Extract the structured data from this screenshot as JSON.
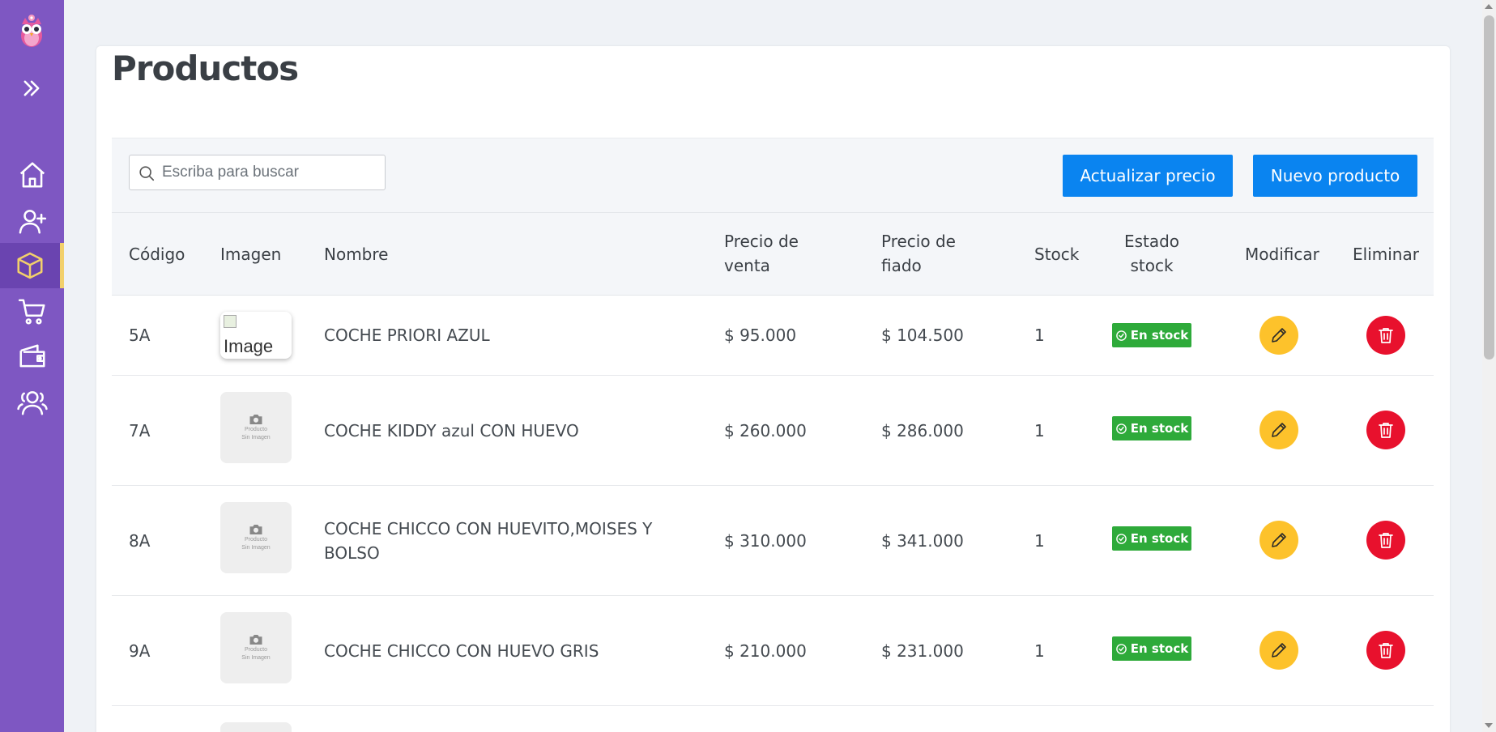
{
  "sidebar": {
    "logo": "owl-logo",
    "items": [
      {
        "icon": "home-icon",
        "active": false
      },
      {
        "icon": "add-user-icon",
        "active": false
      },
      {
        "icon": "box-icon",
        "active": true
      },
      {
        "icon": "cart-icon",
        "active": false
      },
      {
        "icon": "wallet-icon",
        "active": false
      },
      {
        "icon": "users-icon",
        "active": false
      }
    ],
    "accent": "#f2d06b"
  },
  "page": {
    "title": "Productos"
  },
  "toolbar": {
    "search_placeholder": "Escriba para buscar",
    "update_price_label": "Actualizar precio",
    "new_product_label": "Nuevo producto"
  },
  "table": {
    "headers": {
      "codigo": "Código",
      "imagen": "Imagen",
      "nombre": "Nombre",
      "precio_venta_1": "Precio de",
      "precio_venta_2": "venta",
      "precio_fiado_1": "Precio de",
      "precio_fiado_2": "fiado",
      "stock": "Stock",
      "estado_1": "Estado",
      "estado_2": "stock",
      "modificar": "Modificar",
      "eliminar": "Eliminar"
    },
    "image_placeholder_line1": "Producto",
    "image_placeholder_line2": "Sin Imagen",
    "broken_image_alt": "Image",
    "rows": [
      {
        "codigo": "5A",
        "nombre": "COCHE PRIORI AZUL",
        "precio_venta": "$ 95.000",
        "precio_fiado": "$ 104.500",
        "stock": "1",
        "estado": "En stock"
      },
      {
        "codigo": "7A",
        "nombre": "COCHE KIDDY azul CON HUEVO",
        "precio_venta": "$ 260.000",
        "precio_fiado": "$ 286.000",
        "stock": "1",
        "estado": "En stock"
      },
      {
        "codigo": "8A",
        "nombre_1": "COCHE CHICCO CON HUEVITO,MOISES Y",
        "nombre_2": "BOLSO",
        "precio_venta": "$ 310.000",
        "precio_fiado": "$ 341.000",
        "stock": "1",
        "estado": "En stock"
      },
      {
        "codigo": "9A",
        "nombre": "COCHE CHICCO CON HUEVO GRIS",
        "precio_venta": "$ 210.000",
        "precio_fiado": "$ 231.000",
        "stock": "1",
        "estado": "En stock"
      }
    ]
  },
  "colors": {
    "sidebar": "#7e57c2",
    "primary": "#0a84f0",
    "edit": "#fdc22b",
    "delete": "#e8112d",
    "in_stock": "#2eaa3a"
  }
}
